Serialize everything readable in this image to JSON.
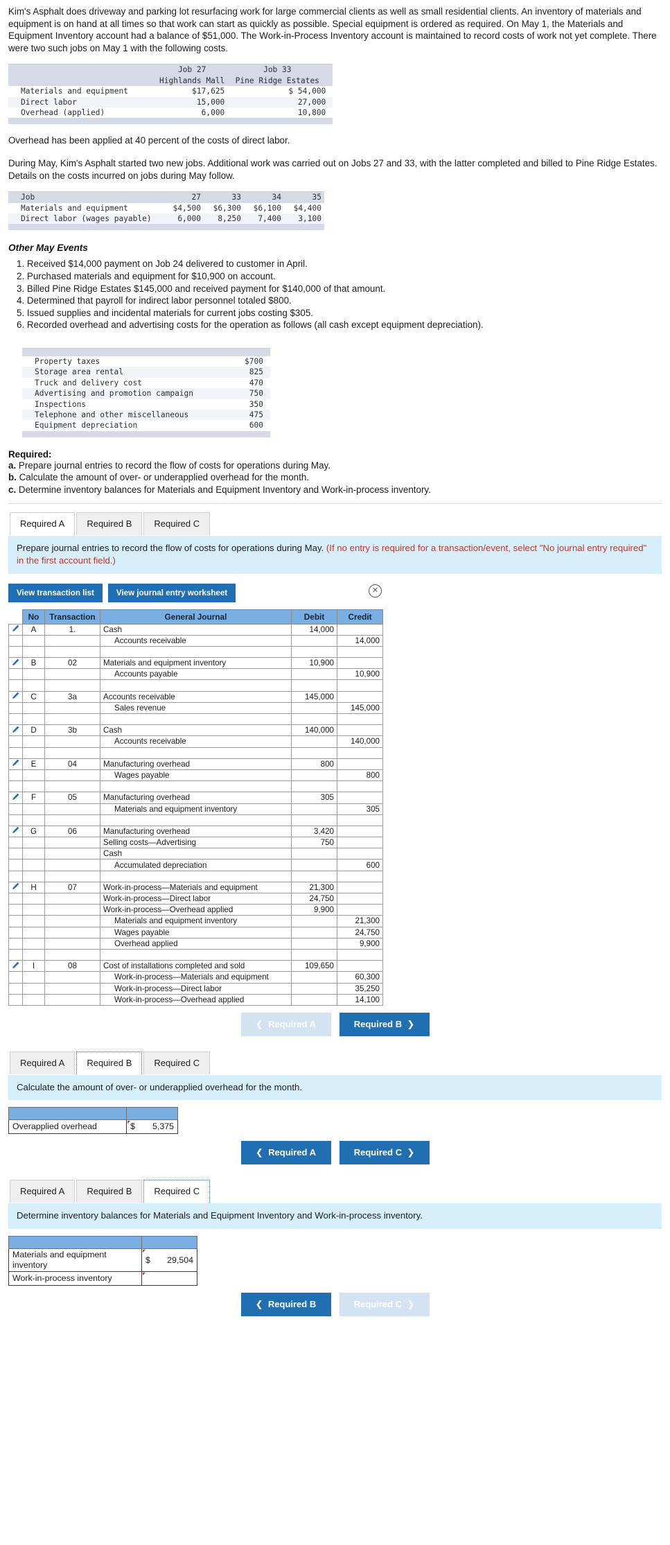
{
  "intro": {
    "paragraph": "Kim's Asphalt does driveway and parking lot resurfacing work for large commercial clients as well as small residential clients. An inventory of materials and equipment is on hand at all times so that work can start as quickly as possible. Special equipment is ordered as required. On May 1, the Materials and Equipment Inventory account had a balance of $51,000. The Work-in-Process Inventory account is maintained to record costs of work not yet complete. There were two such jobs on May 1 with the following costs."
  },
  "beginning_jobs_table": {
    "header": {
      "blank": "",
      "job27_line1": "Job 27",
      "job27_line2": "Highlands Mall",
      "job33_line1": "Job 33",
      "job33_line2": "Pine Ridge Estates"
    },
    "rows": [
      {
        "label": "Materials and equipment",
        "job27": "$17,625",
        "job33": "$ 54,000"
      },
      {
        "label": "Direct labor",
        "job27": "15,000",
        "job33": "27,000"
      },
      {
        "label": "Overhead (applied)",
        "job27": "6,000",
        "job33": "10,800"
      }
    ]
  },
  "overhead_note": "Overhead has been applied at 40 percent of the costs of direct labor.",
  "may_note": "During May, Kim's Asphalt started two new jobs. Additional work was carried out on Jobs 27 and 33, with the latter completed and billed to Pine Ridge Estates. Details on the costs incurred on jobs during May follow.",
  "may_costs_table": {
    "header": {
      "label": "Job",
      "cols": [
        "27",
        "33",
        "34",
        "35"
      ]
    },
    "rows": [
      {
        "label": "Materials and equipment",
        "values": [
          "$4,500",
          "$6,300",
          "$6,100",
          "$4,400"
        ]
      },
      {
        "label": "Direct labor (wages payable)",
        "values": [
          "6,000",
          "8,250",
          "7,400",
          "3,100"
        ]
      }
    ]
  },
  "other_events": {
    "title": "Other May Events",
    "items": [
      "1. Received $14,000 payment on Job 24 delivered to customer in April.",
      "2. Purchased materials and equipment for $10,900 on account.",
      "3. Billed Pine Ridge Estates $145,000 and received payment for $140,000 of that amount.",
      "4. Determined that payroll for indirect labor personnel totaled $800.",
      "5. Issued supplies and incidental materials for current jobs costing $305.",
      "6. Recorded overhead and advertising costs for the operation as follows (all cash except equipment depreciation)."
    ]
  },
  "overhead_costs_table": {
    "rows": [
      {
        "label": "Property taxes",
        "value": "$700"
      },
      {
        "label": "Storage area rental",
        "value": "825"
      },
      {
        "label": "Truck and delivery cost",
        "value": "470"
      },
      {
        "label": "Advertising and promotion campaign",
        "value": "750"
      },
      {
        "label": "Inspections",
        "value": "350"
      },
      {
        "label": "Telephone and other miscellaneous",
        "value": "475"
      },
      {
        "label": "Equipment depreciation",
        "value": "600"
      }
    ]
  },
  "required": {
    "title": "Required:",
    "a_marker": "a.",
    "a_text": "Prepare journal entries to record the flow of costs for operations during May.",
    "b_marker": "b.",
    "b_text": "Calculate the amount of over- or underapplied overhead for the month.",
    "c_marker": "c.",
    "c_text": "Determine inventory balances for Materials and Equipment Inventory and Work-in-process inventory."
  },
  "tabs": {
    "a": "Required A",
    "b": "Required B",
    "c": "Required C"
  },
  "section_a": {
    "banner_main": "Prepare journal entries to record the flow of costs for operations during May. ",
    "banner_red": "(If no entry is required for a transaction/event, select \"No journal entry required\" in the first account field.)",
    "view_transaction_list": "View transaction list",
    "view_journal_worksheet": "View journal entry worksheet",
    "close_icon": "✕",
    "table_headers": {
      "pen": "",
      "no": "No",
      "transaction": "Transaction",
      "general_journal": "General Journal",
      "debit": "Debit",
      "credit": "Credit"
    },
    "entries": [
      {
        "no": "A",
        "transaction": "1.",
        "lines": [
          {
            "account": "Cash",
            "indent": false,
            "debit": "14,000",
            "credit": ""
          },
          {
            "account": "Accounts receivable",
            "indent": true,
            "debit": "",
            "credit": "14,000"
          }
        ]
      },
      {
        "no": "B",
        "transaction": "02",
        "lines": [
          {
            "account": "Materials and equipment inventory",
            "indent": false,
            "debit": "10,900",
            "credit": ""
          },
          {
            "account": "Accounts payable",
            "indent": true,
            "debit": "",
            "credit": "10,900"
          }
        ]
      },
      {
        "no": "C",
        "transaction": "3a",
        "lines": [
          {
            "account": "Accounts receivable",
            "indent": false,
            "debit": "145,000",
            "credit": ""
          },
          {
            "account": "Sales revenue",
            "indent": true,
            "debit": "",
            "credit": "145,000"
          }
        ]
      },
      {
        "no": "D",
        "transaction": "3b",
        "lines": [
          {
            "account": "Cash",
            "indent": false,
            "debit": "140,000",
            "credit": ""
          },
          {
            "account": "Accounts receivable",
            "indent": true,
            "debit": "",
            "credit": "140,000"
          }
        ]
      },
      {
        "no": "E",
        "transaction": "04",
        "lines": [
          {
            "account": "Manufacturing overhead",
            "indent": false,
            "debit": "800",
            "credit": ""
          },
          {
            "account": "Wages payable",
            "indent": true,
            "debit": "",
            "credit": "800"
          }
        ]
      },
      {
        "no": "F",
        "transaction": "05",
        "lines": [
          {
            "account": "Manufacturing overhead",
            "indent": false,
            "debit": "305",
            "credit": ""
          },
          {
            "account": "Materials and equipment inventory",
            "indent": true,
            "debit": "",
            "credit": "305"
          }
        ]
      },
      {
        "no": "G",
        "transaction": "06",
        "lines": [
          {
            "account": "Manufacturing overhead",
            "indent": false,
            "debit": "3,420",
            "credit": ""
          },
          {
            "account": "Selling costs—Advertising",
            "indent": false,
            "debit": "750",
            "credit": ""
          },
          {
            "account": "Cash",
            "indent": false,
            "debit": "",
            "credit": ""
          },
          {
            "account": "Accumulated depreciation",
            "indent": true,
            "debit": "",
            "credit": "600"
          }
        ]
      },
      {
        "no": "H",
        "transaction": "07",
        "lines": [
          {
            "account": "Work-in-process—Materials and equipment",
            "indent": false,
            "debit": "21,300",
            "credit": ""
          },
          {
            "account": "Work-in-process—Direct labor",
            "indent": false,
            "debit": "24,750",
            "credit": ""
          },
          {
            "account": "Work-in-process—Overhead applied",
            "indent": false,
            "debit": "9,900",
            "credit": ""
          },
          {
            "account": "Materials and equipment inventory",
            "indent": true,
            "debit": "",
            "credit": "21,300"
          },
          {
            "account": "Wages payable",
            "indent": true,
            "debit": "",
            "credit": "24,750"
          },
          {
            "account": "Overhead applied",
            "indent": true,
            "debit": "",
            "credit": "9,900"
          }
        ]
      },
      {
        "no": "I",
        "transaction": "08",
        "lines": [
          {
            "account": "Cost of installations completed and sold",
            "indent": false,
            "debit": "109,650",
            "credit": ""
          },
          {
            "account": "Work-in-process—Materials and equipment",
            "indent": true,
            "debit": "",
            "credit": "60,300"
          },
          {
            "account": "Work-in-process—Direct labor",
            "indent": true,
            "debit": "",
            "credit": "35,250"
          },
          {
            "account": "Work-in-process—Overhead applied",
            "indent": true,
            "debit": "",
            "credit": "14,100"
          }
        ]
      }
    ],
    "nav_prev": "Required A",
    "nav_next": "Required B"
  },
  "section_b": {
    "banner": "Calculate the amount of over- or underapplied overhead for the month.",
    "row_label": "Overapplied overhead",
    "row_currency": "$",
    "row_value": "5,375",
    "nav_prev": "Required A",
    "nav_next": "Required C"
  },
  "section_c": {
    "banner": "Determine inventory balances for Materials and Equipment Inventory and Work-in-process inventory.",
    "rows": [
      {
        "label": "Materials and equipment inventory",
        "currency": "$",
        "value": "29,504"
      },
      {
        "label": "Work-in-process inventory",
        "currency": "",
        "value": ""
      }
    ],
    "nav_prev": "Required B",
    "nav_next": "Required C"
  },
  "colors": {
    "banner_blue": "#d7eefb",
    "table_header_blue": "#79aee3",
    "button_blue": "#1f6fb2",
    "button_disabled": "#d3e3f1",
    "exhibit_header": "#d6dae6",
    "red_text": "#c0392b"
  }
}
